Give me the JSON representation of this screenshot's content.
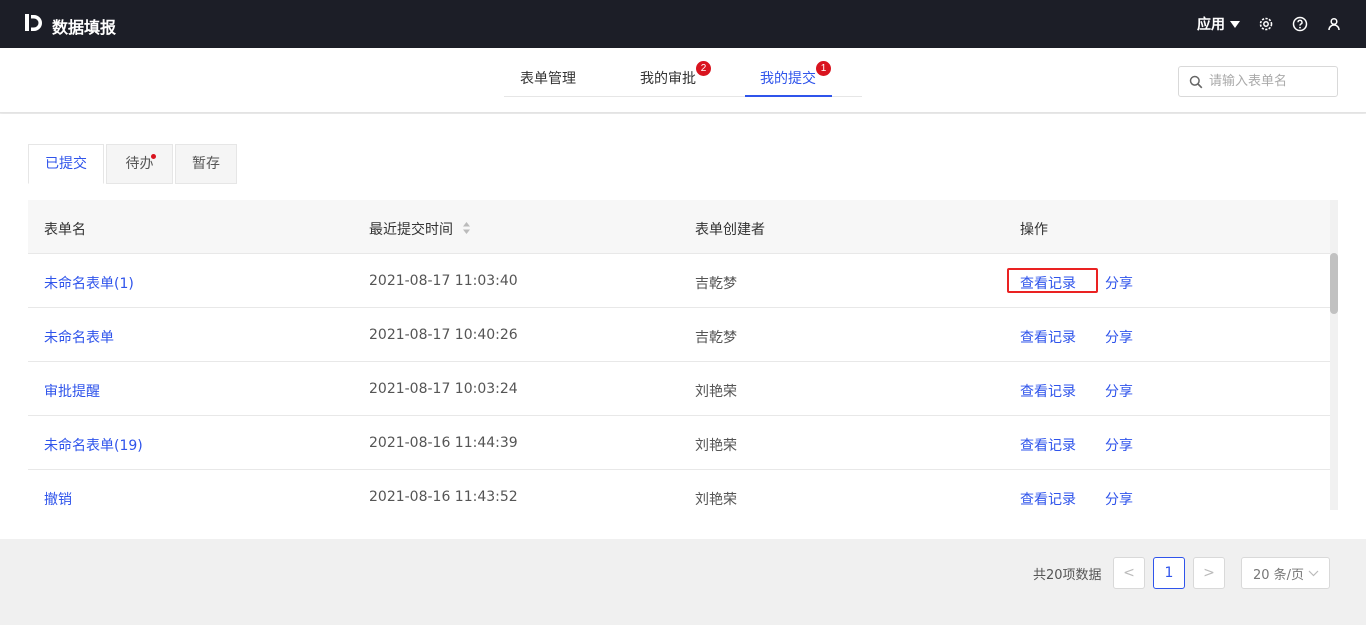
{
  "header": {
    "app_title": "数据填报",
    "apps_label": "应用",
    "icons": [
      "logo-icon",
      "caret-down-icon",
      "settings-icon",
      "help-icon",
      "user-icon"
    ]
  },
  "nav": {
    "tabs": [
      {
        "label": "表单管理",
        "badge": null,
        "active": false
      },
      {
        "label": "我的审批",
        "badge": "2",
        "active": false
      },
      {
        "label": "我的提交",
        "badge": "1",
        "active": true
      }
    ],
    "search_placeholder": "请输入表单名"
  },
  "sub_tabs": [
    {
      "label": "已提交",
      "active": true,
      "dot": false
    },
    {
      "label": "待办",
      "active": false,
      "dot": true
    },
    {
      "label": "暂存",
      "active": false,
      "dot": false
    }
  ],
  "table": {
    "columns": [
      "表单名",
      "最近提交时间",
      "表单创建者",
      "操作"
    ],
    "action_labels": [
      "查看记录",
      "分享"
    ],
    "rows": [
      {
        "name": "未命名表单(1)",
        "time": "2021-08-17 11:03:40",
        "creator": "吉乾梦",
        "highlighted": true
      },
      {
        "name": "未命名表单",
        "time": "2021-08-17 10:40:26",
        "creator": "吉乾梦",
        "highlighted": false
      },
      {
        "name": "审批提醒",
        "time": "2021-08-17 10:03:24",
        "creator": "刘艳荣",
        "highlighted": false
      },
      {
        "name": "未命名表单(19)",
        "time": "2021-08-16 11:44:39",
        "creator": "刘艳荣",
        "highlighted": false
      },
      {
        "name": "撤销",
        "time": "2021-08-16 11:43:52",
        "creator": "刘艳荣",
        "highlighted": false
      }
    ]
  },
  "pagination": {
    "total_text": "共20项数据",
    "current_page": "1",
    "prev_symbol": "<",
    "next_symbol": ">",
    "page_size": "20 条/页"
  },
  "colors": {
    "topbar": "#1c1e27",
    "accent": "#2f54eb",
    "badge": "#d9141f",
    "highlight_border": "#ea2222"
  }
}
